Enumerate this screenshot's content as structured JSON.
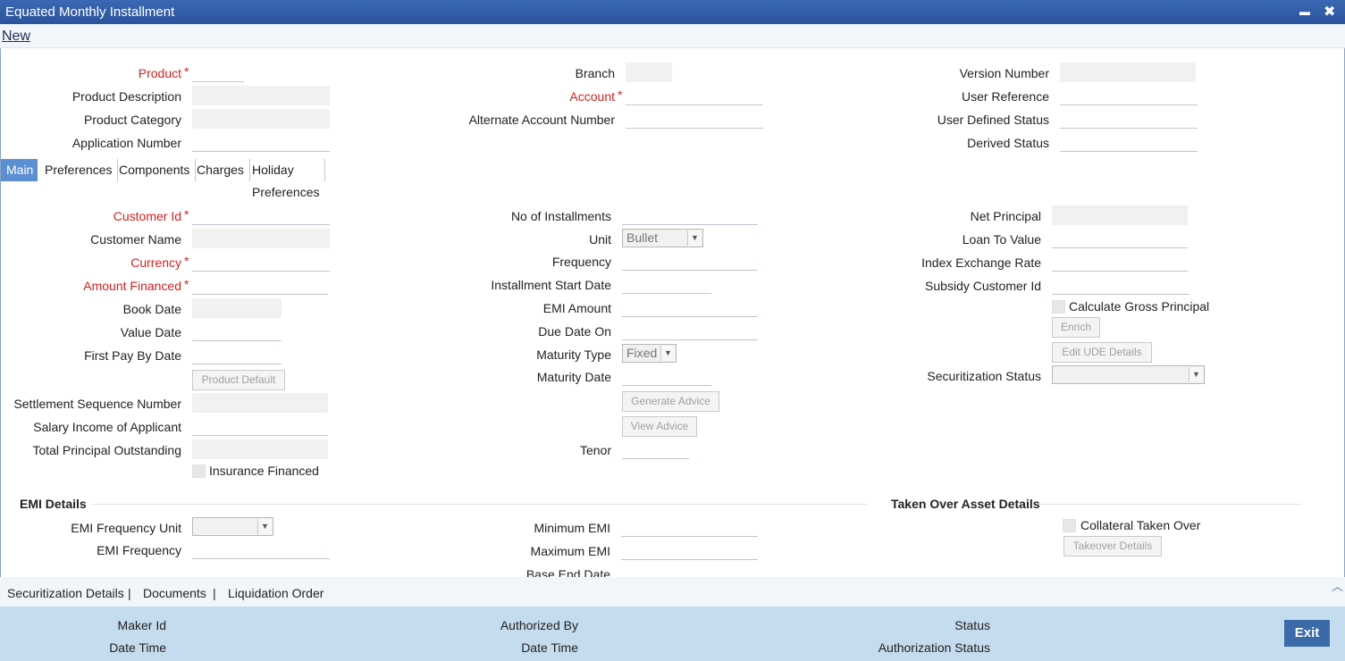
{
  "window": {
    "title": "Equated Monthly Installment",
    "minimize_glyph": "▬",
    "close_glyph": "✖"
  },
  "toolbar": {
    "new_label": "New"
  },
  "header": {
    "product_label": "Product",
    "product_description_label": "Product Description",
    "product_category_label": "Product Category",
    "application_number_label": "Application Number",
    "branch_label": "Branch",
    "account_label": "Account",
    "alternate_account_label": "Alternate Account Number",
    "version_number_label": "Version Number",
    "user_reference_label": "User Reference",
    "user_defined_status_label": "User Defined Status",
    "derived_status_label": "Derived Status",
    "required_mark": "*"
  },
  "tabs": [
    "Main",
    "Preferences",
    "Components",
    "Charges",
    "Holiday Preferences"
  ],
  "main": {
    "customer_id_label": "Customer Id",
    "customer_name_label": "Customer Name",
    "currency_label": "Currency",
    "amount_financed_label": "Amount Financed",
    "book_date_label": "Book Date",
    "value_date_label": "Value Date",
    "first_pay_by_date_label": "First Pay By Date",
    "product_default_button": "Product Default",
    "settlement_sequence_label": "Settlement Sequence Number",
    "salary_income_label": "Salary Income of Applicant",
    "total_principal_label": "Total Principal Outstanding",
    "insurance_financed_label": "Insurance Financed",
    "no_of_installments_label": "No of Installments",
    "unit_label": "Unit",
    "unit_value": "Bullet",
    "frequency_label": "Frequency",
    "installment_start_date_label": "Installment Start Date",
    "emi_amount_label": "EMI Amount",
    "due_date_on_label": "Due Date On",
    "maturity_type_label": "Maturity Type",
    "maturity_type_value": "Fixed",
    "maturity_date_label": "Maturity Date",
    "generate_advice_button": "Generate Advice",
    "view_advice_button": "View Advice",
    "tenor_label": "Tenor",
    "net_principal_label": "Net Principal",
    "loan_to_value_label": "Loan To Value",
    "index_exchange_rate_label": "Index Exchange Rate",
    "subsidy_customer_id_label": "Subsidy Customer Id",
    "calculate_gross_principal_label": "Calculate Gross Principal",
    "enrich_button": "Enrich",
    "edit_ude_button": "Edit UDE Details",
    "securitization_status_label": "Securitization Status"
  },
  "emi_details": {
    "section_title": "EMI Details",
    "emi_frequency_unit_label": "EMI Frequency Unit",
    "emi_frequency_label": "EMI Frequency",
    "minimum_emi_label": "Minimum EMI",
    "maximum_emi_label": "Maximum EMI",
    "base_end_date_label": "Base End Date"
  },
  "taken_over": {
    "section_title": "Taken Over Asset Details",
    "collateral_taken_over_label": "Collateral Taken Over",
    "takeover_details_button": "Takeover Details"
  },
  "subtabs": {
    "securitization": "Securitization Details",
    "documents": "Documents",
    "liquidation": "Liquidation Order",
    "separator": "|",
    "scroll_up_glyph": "︿"
  },
  "footer": {
    "maker_id_label": "Maker Id",
    "date_time_label": "Date Time",
    "authorized_by_label": "Authorized By",
    "date_time2_label": "Date Time",
    "status_label": "Status",
    "authorization_status_label": "Authorization Status",
    "exit_label": "Exit"
  },
  "icons": {
    "dropdown": "chevron-down-icon",
    "minimize": "minimize-icon",
    "close": "close-icon"
  }
}
